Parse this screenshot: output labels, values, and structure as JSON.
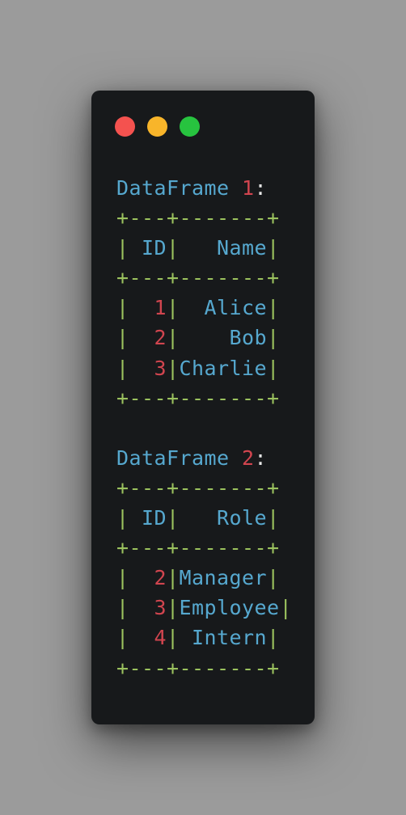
{
  "colors": {
    "text_blue": "#56a8cf",
    "number_red": "#d1454f",
    "border_green": "#9bc25e",
    "punct_white": "#e6e6e6",
    "close": "#f4524f",
    "minimize": "#f8b52a",
    "maximize": "#27c33f"
  },
  "window_controls": [
    {
      "name": "close-button",
      "color": "#f4524f"
    },
    {
      "name": "minimize-button",
      "color": "#f8b52a"
    },
    {
      "name": "maximize-button",
      "color": "#27c33f"
    }
  ],
  "lines": [
    [
      {
        "t": "DataFrame ",
        "c": "blue"
      },
      {
        "t": "1",
        "c": "red"
      },
      {
        "t": ":",
        "c": "white"
      }
    ],
    [
      {
        "t": "+---+-------+",
        "c": "green"
      }
    ],
    [
      {
        "t": "| ",
        "c": "green"
      },
      {
        "t": "ID",
        "c": "blue"
      },
      {
        "t": "|",
        "c": "green"
      },
      {
        "t": "   Name",
        "c": "blue"
      },
      {
        "t": "|",
        "c": "green"
      }
    ],
    [
      {
        "t": "+---+-------+",
        "c": "green"
      }
    ],
    [
      {
        "t": "|  ",
        "c": "green"
      },
      {
        "t": "1",
        "c": "red"
      },
      {
        "t": "|",
        "c": "green"
      },
      {
        "t": "  Alice",
        "c": "blue"
      },
      {
        "t": "|",
        "c": "green"
      }
    ],
    [
      {
        "t": "|  ",
        "c": "green"
      },
      {
        "t": "2",
        "c": "red"
      },
      {
        "t": "|",
        "c": "green"
      },
      {
        "t": "    Bob",
        "c": "blue"
      },
      {
        "t": "|",
        "c": "green"
      }
    ],
    [
      {
        "t": "|  ",
        "c": "green"
      },
      {
        "t": "3",
        "c": "red"
      },
      {
        "t": "|",
        "c": "green"
      },
      {
        "t": "Charlie",
        "c": "blue"
      },
      {
        "t": "|",
        "c": "green"
      }
    ],
    [
      {
        "t": "+---+-------+",
        "c": "green"
      }
    ],
    [],
    [
      {
        "t": "DataFrame ",
        "c": "blue"
      },
      {
        "t": "2",
        "c": "red"
      },
      {
        "t": ":",
        "c": "white"
      }
    ],
    [
      {
        "t": "+---+-------+",
        "c": "green"
      }
    ],
    [
      {
        "t": "| ",
        "c": "green"
      },
      {
        "t": "ID",
        "c": "blue"
      },
      {
        "t": "|",
        "c": "green"
      },
      {
        "t": "   Role",
        "c": "blue"
      },
      {
        "t": "|",
        "c": "green"
      }
    ],
    [
      {
        "t": "+---+-------+",
        "c": "green"
      }
    ],
    [
      {
        "t": "|  ",
        "c": "green"
      },
      {
        "t": "2",
        "c": "red"
      },
      {
        "t": "|",
        "c": "green"
      },
      {
        "t": "Manager",
        "c": "blue"
      },
      {
        "t": "|",
        "c": "green"
      }
    ],
    [
      {
        "t": "|  ",
        "c": "green"
      },
      {
        "t": "3",
        "c": "red"
      },
      {
        "t": "|",
        "c": "green"
      },
      {
        "t": "Employee",
        "c": "blue"
      },
      {
        "t": "|",
        "c": "green"
      }
    ],
    [
      {
        "t": "|  ",
        "c": "green"
      },
      {
        "t": "4",
        "c": "red"
      },
      {
        "t": "|",
        "c": "green"
      },
      {
        "t": " Intern",
        "c": "blue"
      },
      {
        "t": "|",
        "c": "green"
      }
    ],
    [
      {
        "t": "+---+-------+",
        "c": "green"
      }
    ]
  ]
}
